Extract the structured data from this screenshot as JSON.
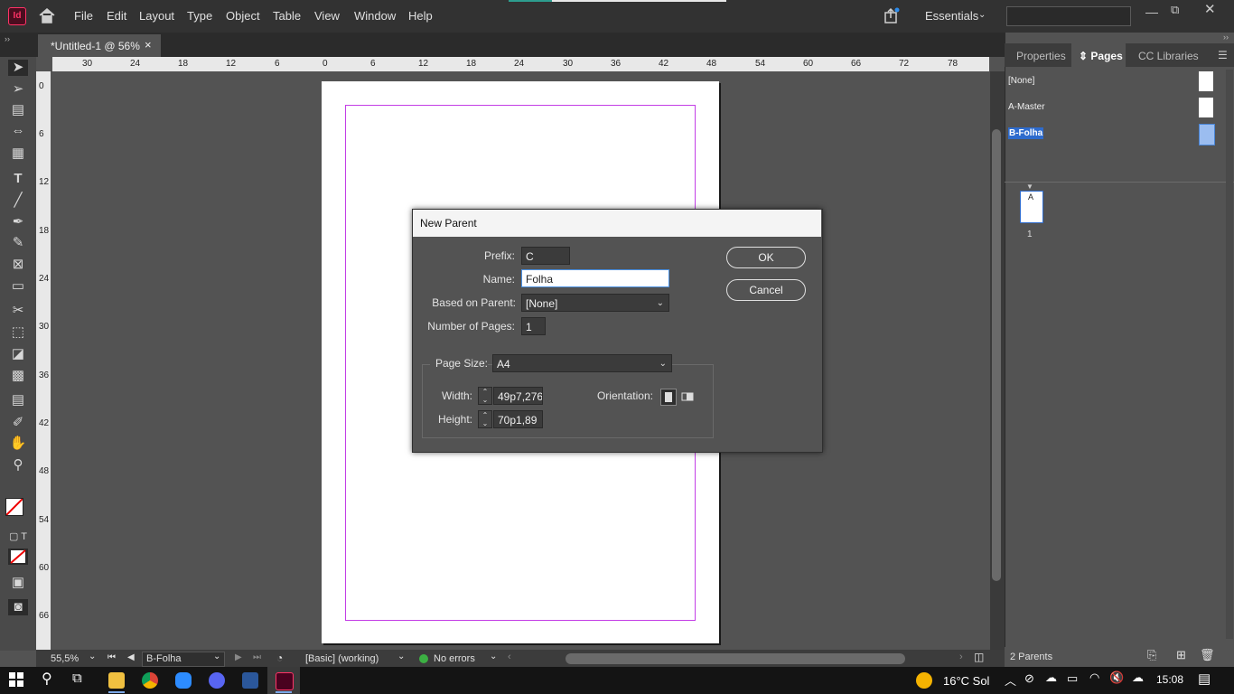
{
  "app": {
    "name": "Id",
    "accent": "#ff3366",
    "workspace": "Essentials"
  },
  "menus": [
    "File",
    "Edit",
    "Layout",
    "Type",
    "Object",
    "Table",
    "View",
    "Window",
    "Help"
  ],
  "document_tab": {
    "title": "*Untitled-1 @ 56%",
    "close": "×"
  },
  "ruler": {
    "h_ticks": [
      "30",
      "24",
      "18",
      "12",
      "6",
      "0",
      "6",
      "12",
      "18",
      "24",
      "30",
      "36",
      "42",
      "48",
      "54",
      "60",
      "66",
      "72",
      "78"
    ],
    "v_ticks": [
      "0",
      "6",
      "12",
      "18",
      "24",
      "30",
      "36",
      "42",
      "48",
      "54",
      "60",
      "66"
    ]
  },
  "status": {
    "zoom": "55,5%",
    "page": "B-Folha",
    "style": "[Basic] (working)",
    "errors": "No errors"
  },
  "panel": {
    "tabs": [
      "Properties",
      "Pages",
      "CC Libraries"
    ],
    "active_tab": "Pages",
    "parents": [
      "[None]",
      "A-Master",
      "B-Folha"
    ],
    "selected_parent": "B-Folha",
    "page_thumb_label": "A",
    "page_number": "1",
    "footer": "2 Parents"
  },
  "dialog": {
    "title": "New Parent",
    "prefix_label": "Prefix:",
    "prefix": "C",
    "name_label": "Name:",
    "name": "Folha",
    "based_label": "Based on Parent:",
    "based": "[None]",
    "pages_label": "Number of Pages:",
    "pages": "1",
    "size_label": "Page Size:",
    "size": "A4",
    "width_label": "Width:",
    "width": "49p7,276",
    "height_label": "Height:",
    "height": "70p1,89",
    "orientation_label": "Orientation:",
    "ok": "OK",
    "cancel": "Cancel"
  },
  "taskbar": {
    "weather": "16°C Sol",
    "time": "15:08"
  }
}
